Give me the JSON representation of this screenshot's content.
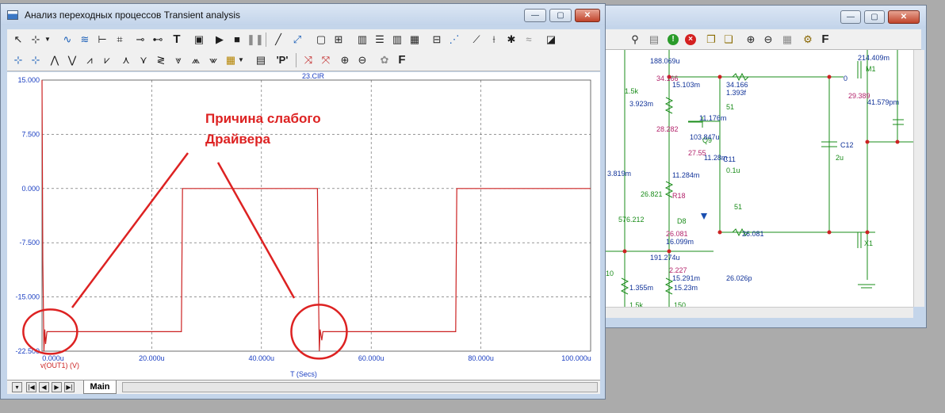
{
  "back_window": {
    "controls": {
      "minimize": "—",
      "maximize": "▢",
      "close": "✕"
    },
    "toolbar_icons": [
      "binoculars-icon",
      "chip-icon",
      "run-icon",
      "stop-icon",
      "copy-icon",
      "paste-icon",
      "zoom-in-icon",
      "zoom-out-icon",
      "image-icon",
      "gear-icon",
      "font-icon"
    ],
    "font_button": "F",
    "go_glyph": "!",
    "stop_glyph": "×",
    "schematic_labels": [
      "188.069u",
      "34.166",
      "15.103m",
      "34.166",
      "1.393f",
      "214.409m",
      "M1",
      "1.5k",
      "3.923m",
      "51",
      "29.389",
      "41.579pm",
      "11.176m",
      "28.282",
      "Q9",
      "103.847u",
      "27.55",
      "11.28m",
      "C11",
      "0.1u",
      "C12",
      "2u",
      "3.819m",
      "11.284m",
      "R18",
      "26.821",
      "D8",
      "51",
      "576.212",
      "26.081",
      "26.081",
      "16.099m",
      "X1",
      "191.274u",
      "10",
      "2.227",
      "15.291m",
      "26.026p",
      "1.355m",
      "15.23m",
      "1.5k",
      "150",
      "0"
    ]
  },
  "front_window": {
    "title": "Анализ переходных процессов Transient analysis",
    "controls": {
      "minimize": "—",
      "maximize": "▢",
      "close": "✕"
    },
    "toolbar1_font_button": "F",
    "toolbar2_p_button": "'P'",
    "toolbar2_font_button": "F",
    "tabs": {
      "main": "Main"
    },
    "nav_glyphs": [
      "▾",
      "|◀",
      "◀",
      "▶",
      "▶|"
    ]
  },
  "annotations": {
    "text_line1": "Причина слабого",
    "text_line2": "Драйвера",
    "color": "#dd2222"
  },
  "chart_data": {
    "type": "line",
    "title": "23.CIR",
    "xlabel": "T (Secs)",
    "ylabel": "v(OUT1) (V)",
    "xlim": [
      0,
      100
    ],
    "ylim": [
      -22.5,
      15
    ],
    "x_unit": "u",
    "x_ticks": [
      "0.000u",
      "20.000u",
      "40.000u",
      "60.000u",
      "80.000u",
      "100.000u"
    ],
    "y_ticks": [
      "15.000",
      "7.500",
      "0.000",
      "-7.500",
      "-15.000",
      "-22.500"
    ],
    "y_tick_values": [
      15,
      7.5,
      0,
      -7.5,
      -15,
      -22.5
    ],
    "grid": true,
    "series": [
      {
        "name": "v(OUT1) (V)",
        "color": "#cc2222",
        "x": [
          0,
          0.15,
          0.35,
          0.5,
          0.65,
          0.9,
          1.2,
          25.0,
          25.4,
          25.6,
          50.2,
          50.4,
          50.55,
          50.7,
          51.0,
          51.2,
          75.0,
          75.4,
          75.6,
          100
        ],
        "y": [
          15,
          -10,
          -22.5,
          -19.5,
          -21.5,
          -19.8,
          -19.8,
          -19.8,
          -19.8,
          0,
          0,
          -15,
          -22.5,
          -19.5,
          -21.0,
          -19.8,
          -19.8,
          -19.8,
          0,
          0
        ]
      }
    ]
  }
}
